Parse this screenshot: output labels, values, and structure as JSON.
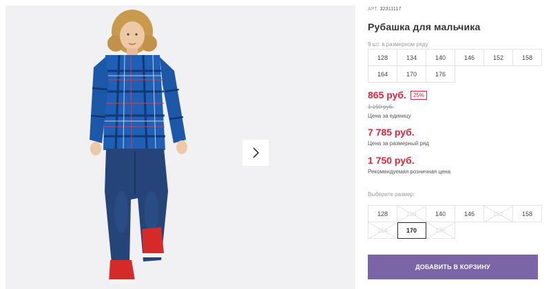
{
  "product": {
    "art_label": "АРТ.",
    "art_number": "32311117",
    "title": "Рубашка для мальчика"
  },
  "size_range": {
    "note": "9 шт. в размерном ряду",
    "sizes": [
      "128",
      "134",
      "140",
      "146",
      "152",
      "158",
      "164",
      "170",
      "176"
    ]
  },
  "prices": {
    "unit_price": "865 руб.",
    "discount": "25%",
    "old_price": "1 150 руб.",
    "unit_caption": "Цена за единицу",
    "range_price": "7 785 руб.",
    "range_caption": "Цена за размерный ряд",
    "retail_price": "1 750 руб.",
    "retail_caption": "Рекомендуемая розничная цена"
  },
  "size_select": {
    "label": "Выберите размер:",
    "options": [
      {
        "size": "128",
        "available": true
      },
      {
        "size": "134",
        "available": false
      },
      {
        "size": "140",
        "available": true
      },
      {
        "size": "146",
        "available": true
      },
      {
        "size": "152",
        "available": false
      },
      {
        "size": "158",
        "available": true
      },
      {
        "size": "164",
        "available": false
      },
      {
        "size": "170",
        "available": true,
        "selected": true
      },
      {
        "size": "176",
        "available": false
      }
    ]
  },
  "cart": {
    "button_label": "Добавить в корзину"
  },
  "gallery": {
    "next_icon": "chevron-right-icon"
  },
  "colors": {
    "price_red": "#d7263d",
    "button_purple": "#7b65a7",
    "gallery_bg": "#f1f1f3"
  }
}
